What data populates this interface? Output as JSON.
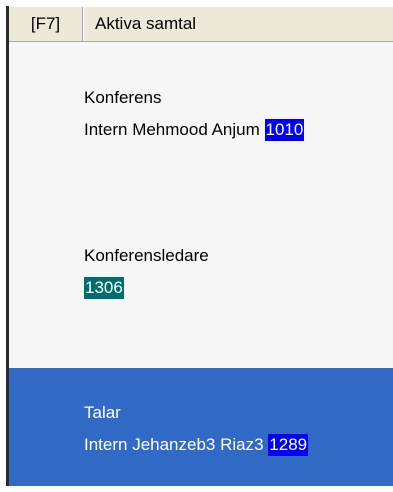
{
  "header": {
    "hotkey": "[F7]",
    "title": "Aktiva samtal"
  },
  "calls": [
    {
      "type": "Konferens",
      "name": "Intern Mehmood Anjum",
      "number": "1010",
      "number_color": "#0000f5",
      "selected": false
    },
    {
      "type": "Konferensledare",
      "name": "",
      "number": "1306",
      "number_color": "#006e6e",
      "selected": false
    },
    {
      "type": "Talar",
      "name": "Intern Jehanzeb3 Riaz3",
      "number": "1289",
      "number_color": "#0000f5",
      "selected": true
    }
  ],
  "colors": {
    "header_bg": "#ece9d8",
    "list_bg": "#f6f6f6",
    "selection_bg": "#316ac5"
  }
}
